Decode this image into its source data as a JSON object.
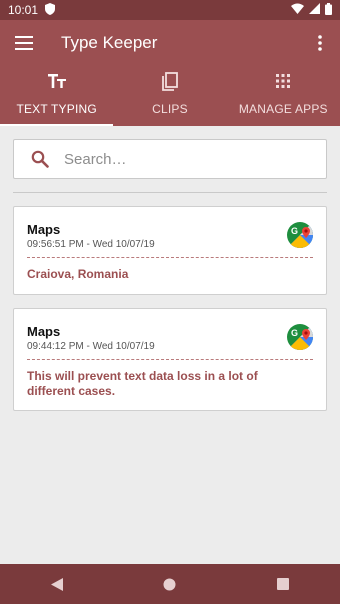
{
  "status_bar": {
    "time": "10:01",
    "icons": [
      "shield-icon",
      "wifi-icon",
      "signal-icon",
      "battery-icon"
    ]
  },
  "app_bar": {
    "title": "Type Keeper",
    "menu_icon": "hamburger-menu-icon",
    "more_icon": "more-vert-icon"
  },
  "tabs": [
    {
      "label": "TEXT TYPING",
      "icon": "text-format-icon",
      "active": true
    },
    {
      "label": "CLIPS",
      "icon": "copy-icon",
      "active": false
    },
    {
      "label": "MANAGE APPS",
      "icon": "apps-grid-icon",
      "active": false
    }
  ],
  "search": {
    "placeholder": "Search…",
    "value": ""
  },
  "entries": [
    {
      "app": "Maps",
      "time": "09:56:51 PM - Wed 10/07/19",
      "text": "Craiova, Romania",
      "icon": "google-maps-icon"
    },
    {
      "app": "Maps",
      "time": "09:44:12 PM - Wed 10/07/19",
      "text": "This will prevent text data loss in a lot of different cases.",
      "icon": "google-maps-icon"
    }
  ],
  "colors": {
    "primary": "#9b4f51",
    "primary_dark": "#7a3a3c",
    "accent_text": "#9b4f51",
    "background": "#ececec"
  },
  "nav_bar": [
    "back-icon",
    "home-icon",
    "recents-icon"
  ]
}
